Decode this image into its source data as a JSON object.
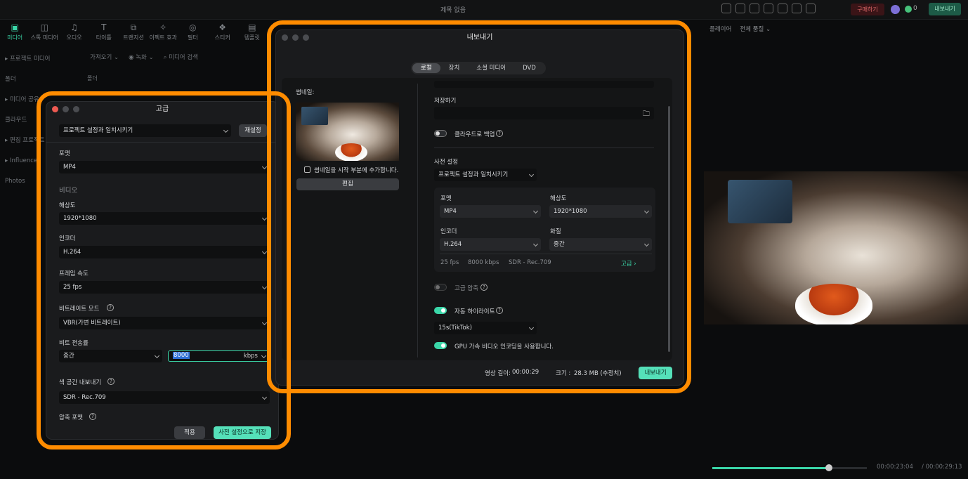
{
  "window": {
    "title": "제목 없음"
  },
  "header": {
    "buy_label": "구매하기",
    "credit_count": "0",
    "export_label": "내보내기"
  },
  "toolbar": [
    {
      "label": "미디어",
      "icon": "media-icon",
      "glyph": "▣",
      "active": true
    },
    {
      "label": "스톡 미디어",
      "icon": "stock-media-icon",
      "glyph": "◫",
      "active": false
    },
    {
      "label": "오디오",
      "icon": "music-note-icon",
      "glyph": "♫",
      "active": false
    },
    {
      "label": "타이틀",
      "icon": "title-t-icon",
      "glyph": "T",
      "active": false
    },
    {
      "label": "트랜지션",
      "icon": "transition-icon",
      "glyph": "⧉",
      "active": false
    },
    {
      "label": "이펙트 효과",
      "icon": "effects-icon",
      "glyph": "✧",
      "active": false
    },
    {
      "label": "필터",
      "icon": "filter-icon",
      "glyph": "◎",
      "active": false
    },
    {
      "label": "스티커",
      "icon": "sticker-icon",
      "glyph": "❖",
      "active": false
    },
    {
      "label": "템플릿",
      "icon": "template-icon",
      "glyph": "▤",
      "active": false
    }
  ],
  "sidebar": [
    {
      "label": "▸ 프로젝트 미디어"
    },
    {
      "label": "폴더"
    },
    {
      "label": "▸ 미디어 공유"
    },
    {
      "label": "클라우드"
    },
    {
      "label": "▸ 편집 프로젝트"
    },
    {
      "label": "▸ Influence"
    },
    {
      "label": "Photos"
    }
  ],
  "subbar": {
    "import_label": "가져오기 ⌄",
    "record_label": "◉ 녹화 ⌄",
    "search_placeholder": "⌕ 미디어 검색"
  },
  "folder_label": "폴더",
  "right_panel": {
    "player_label": "플레이어",
    "quality_label": "전체 품질 ⌄"
  },
  "timecode": {
    "current": "00:00:23:04",
    "total": "/ 00:00:29:13"
  },
  "playback": {
    "progress": 0.755
  },
  "advanced": {
    "title": "고급",
    "preset": "프로젝트 설정과 일치시키기",
    "reset": "재설정",
    "format_label": "포맷",
    "format": "MP4",
    "video_section": "비디오",
    "resolution_label": "해상도",
    "resolution": "1920*1080",
    "encoder_label": "인코더",
    "encoder": "H.264",
    "framerate_label": "프레임 속도",
    "framerate": "25 fps",
    "bitrate_mode_label": "비트레이트 모드",
    "bitrate_mode": "VBR(가변 비트레이트)",
    "bitrate_label": "비트 전송률",
    "bitrate_quality": "중간",
    "bitrate_value": "8000",
    "bitrate_unit": "kbps",
    "colorspace_label": "색 공간 내보내기",
    "colorspace": "SDR - Rec.709",
    "compression_label": "압축 포맷",
    "apply": "적용",
    "save_preset": "사전 설정으로 저장"
  },
  "export": {
    "title": "내보내기",
    "tabs": [
      "로컬",
      "장치",
      "소셜 미디어",
      "DVD"
    ],
    "active_tab": 0,
    "thumbnail_label": "썸네일:",
    "add_thumbnail_label": "썸네일을 시작 부분에 추가합니다.",
    "edit_label": "편집",
    "save_to_label": "저장하기",
    "cloud_backup_label": "클라우드로 백업",
    "preset_section": "사전 설정",
    "preset": "프로젝트 설정과 일치시키기",
    "format_label": "포맷",
    "format": "MP4",
    "resolution_label": "해상도",
    "resolution": "1920*1080",
    "encoder_label": "인코더",
    "encoder": "H.264",
    "quality_label": "화질",
    "quality": "중간",
    "summary_fps": "25 fps",
    "summary_bitrate": "8000 kbps",
    "summary_color": "SDR - Rec.709",
    "advanced_link": "고급 ›",
    "hq_compression_label": "고급 압축",
    "auto_highlight_label": "자동 하이라이트",
    "highlight_duration": "15s(TikTok)",
    "gpu_label": "GPU 가속 비디오 인코딩을 사용합니다.",
    "duration_label": "영상 길이:",
    "duration": "00:00:29",
    "size_label": "크기 :",
    "size": "28.3 MB (추정치)",
    "export_button": "내보내기"
  },
  "colors": {
    "accent": "#3ad6a8",
    "highlight": "#ff8c00",
    "bg": "#0b0c0d"
  }
}
